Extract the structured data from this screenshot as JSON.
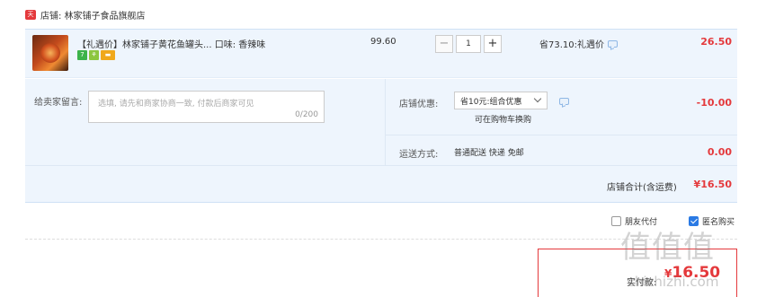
{
  "shop": {
    "icon_text": "天猫",
    "name": "店铺: 林家铺子食品旗舰店"
  },
  "item": {
    "title": "【礼遇价】林家铺子黄花鱼罐头... 口味: 香辣味",
    "tags": [
      "7",
      "⚘",
      "▬"
    ],
    "price": "99.60",
    "quantity": "1",
    "qty_minus": "−",
    "qty_plus": "+",
    "saving": "省73.10:礼遇价",
    "subtotal": "26.50"
  },
  "memo": {
    "label": "给卖家留言:",
    "placeholder": "选填, 请先和商家协商一致, 付款后商家可见",
    "count": "0/200"
  },
  "coupon": {
    "label": "店铺优惠:",
    "selected": "省10元:组合优惠",
    "note": "可在购物车换购",
    "amount": "-10.00"
  },
  "shipping": {
    "label": "运送方式:",
    "method": "普通配送 快递 免邮",
    "amount": "0.00"
  },
  "total": {
    "label": "店铺合计(含运费)",
    "amount": "¥16.50"
  },
  "options": {
    "friend_pay": "朋友代付",
    "anonymous": "匿名购买"
  },
  "payment": {
    "label": "实付款:",
    "currency": "¥",
    "amount": "16.50"
  },
  "watermark": {
    "logo": "值值值",
    "site": "zhizhizhi.com"
  }
}
